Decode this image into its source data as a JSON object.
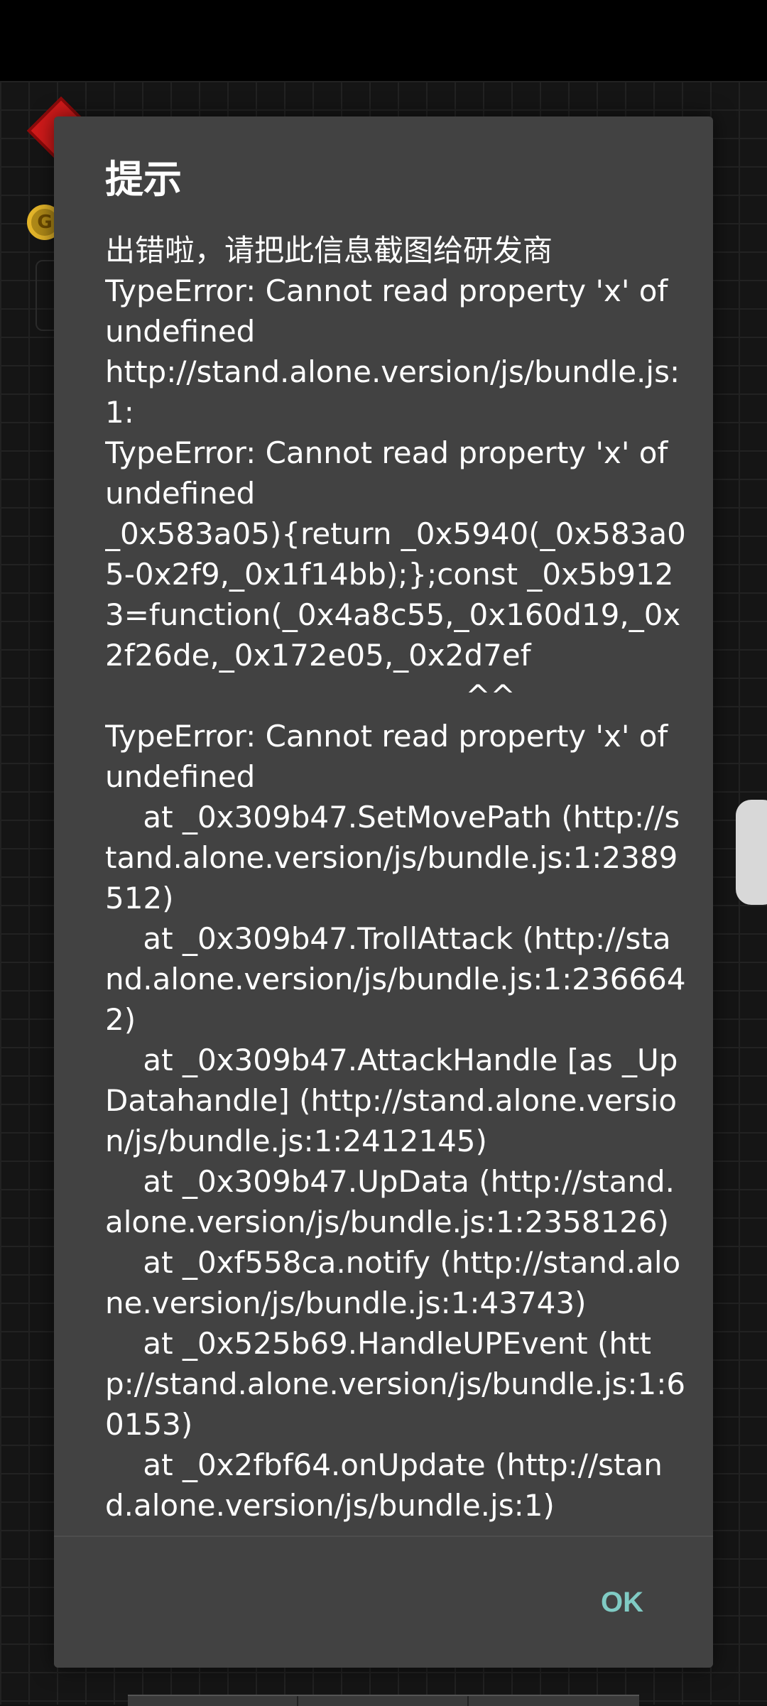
{
  "dialog": {
    "title": "提示",
    "message": "出错啦，请把此信息截图给研发商\nTypeError: Cannot read property 'x' of undefined\nhttp://stand.alone.version/js/bundle.js:1:\nTypeError: Cannot read property 'x' of undefined\n_0x583a05){return _0x5940(_0x583a05-0x2f9,_0x1f14bb);};const _0x5b9123=function(_0x4a8c55,_0x160d19,_0x2f26de,_0x172e05,_0x2d7ef\n                                      ^^\nTypeError: Cannot read property 'x' of undefined\n    at _0x309b47.SetMovePath (http://stand.alone.version/js/bundle.js:1:2389512)\n    at _0x309b47.TrollAttack (http://stand.alone.version/js/bundle.js:1:2366642)\n    at _0x309b47.AttackHandle [as _UpDatahandle] (http://stand.alone.version/js/bundle.js:1:2412145)\n    at _0x309b47.UpData (http://stand.alone.version/js/bundle.js:1:2358126)\n    at _0xf558ca.notify (http://stand.alone.version/js/bundle.js:1:43743)\n    at _0x525b69.HandleUPEvent (http://stand.alone.version/js/bundle.js:1:60153)\n    at _0x2fbf64.onUpdate (http://stand.alone.version/js/bundle.js:1)",
    "ok_label": "OK"
  },
  "background": {
    "coin_glyph": "G"
  },
  "colors": {
    "dialog_bg": "#424242",
    "accent": "#80cbc4",
    "text": "#ffffff"
  }
}
